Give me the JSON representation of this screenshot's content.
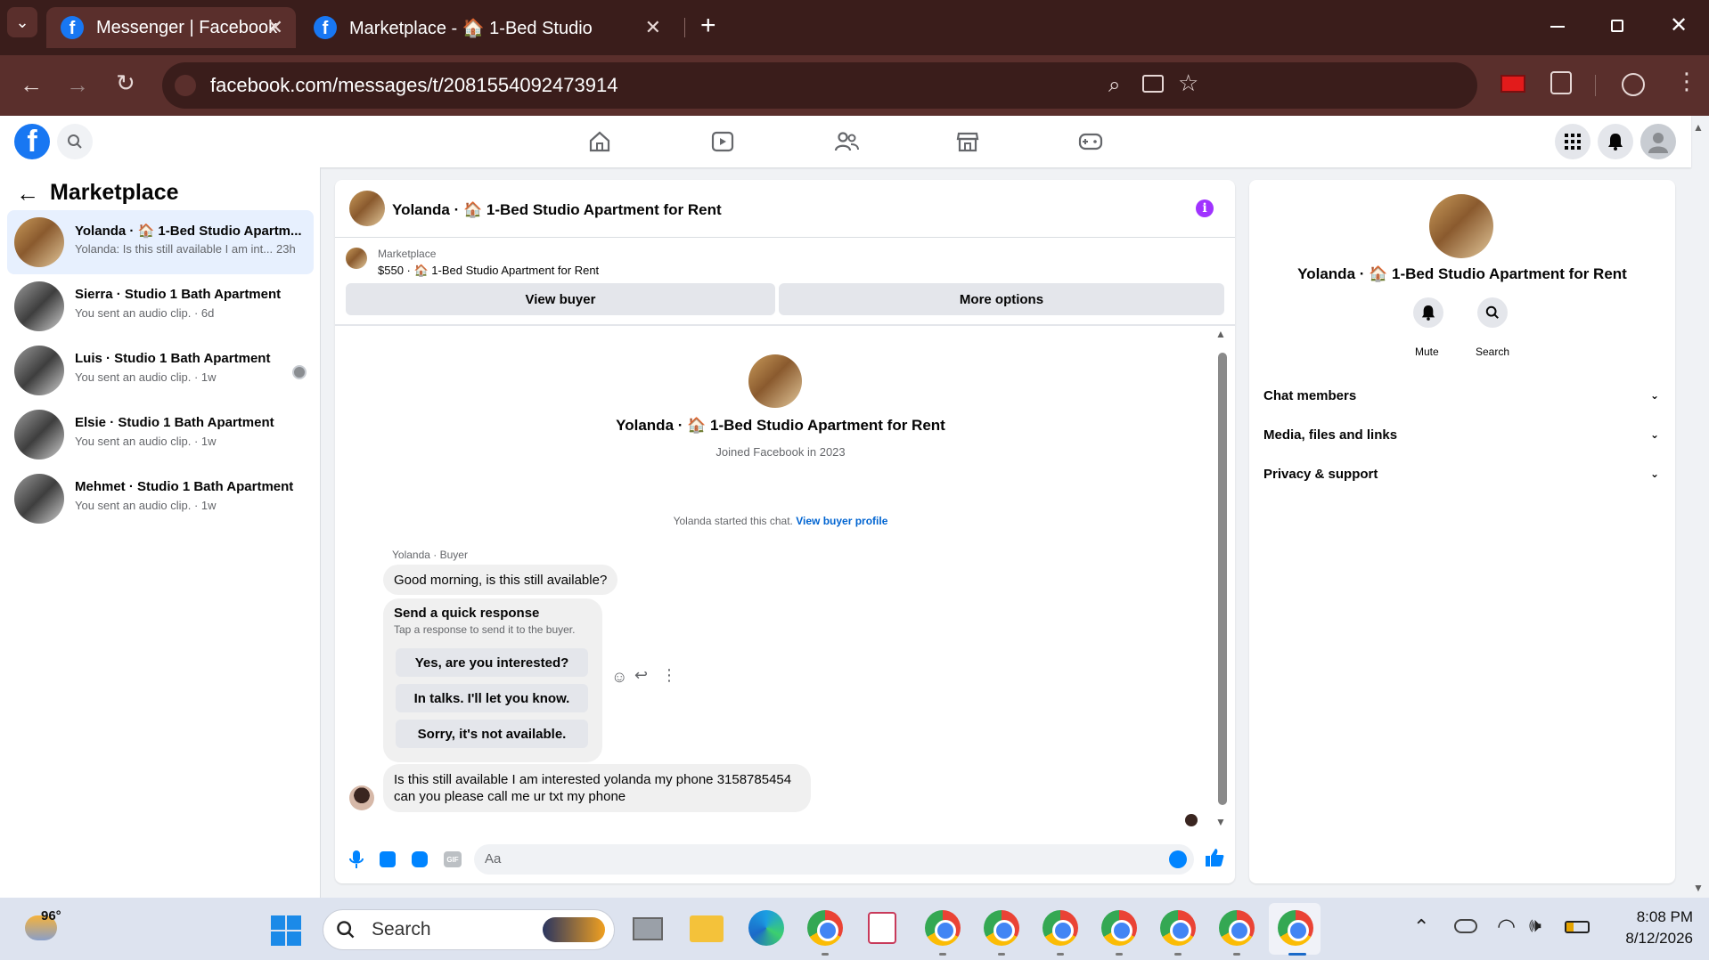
{
  "browser": {
    "tabs": [
      {
        "title": "Messenger | Facebook",
        "active": true
      },
      {
        "title": "Marketplace - 🏠 1-Bed Studio",
        "active": false
      }
    ],
    "url": "facebook.com/messages/t/2081554092473914",
    "new_tab": "+",
    "close": "✕"
  },
  "left_panel": {
    "title": "Marketplace",
    "conversations": [
      {
        "title": "Yolanda · 🏠 1-Bed Studio Apartm...",
        "snippet": "Yolanda: Is this still available I am int...",
        "time": "23h",
        "selected": true
      },
      {
        "title": "Sierra · Studio 1 Bath Apartment",
        "snippet": "You sent an audio clip. · 6d",
        "time": "",
        "selected": false
      },
      {
        "title": "Luis · Studio 1 Bath Apartment",
        "snippet": "You sent an audio clip. · 1w",
        "time": "",
        "selected": false
      },
      {
        "title": "Elsie · Studio 1 Bath Apartment",
        "snippet": "You sent an audio clip. · 1w",
        "time": "",
        "selected": false
      },
      {
        "title": "Mehmet · Studio 1 Bath Apartment",
        "snippet": "You sent an audio clip. · 1w",
        "time": "",
        "selected": false
      }
    ]
  },
  "chat": {
    "header_title": "Yolanda · 🏠 1-Bed Studio Apartment for Rent",
    "listing_label": "Marketplace",
    "listing_price": "$550 · 🏠 1-Bed Studio Apartment for Rent",
    "view_buyer": "View buyer",
    "more_options": "More options",
    "profile_name": "Yolanda · 🏠 1-Bed Studio Apartment for Rent",
    "joined": "Joined Facebook in 2023",
    "started_text": "Yolanda started this chat.",
    "view_buyer_profile": "View buyer profile",
    "sender_label": "Yolanda · Buyer",
    "message1": "Good morning, is this still available?",
    "quick_title": "Send a quick response",
    "quick_sub": "Tap a response to send it to the buyer.",
    "quick_responses": [
      "Yes, are you interested?",
      "In talks. I'll let you know.",
      "Sorry, it's not available."
    ],
    "message2": "Is this still available I am interested yolanda my phone 3158785454 can you please call me ur txt my phone",
    "composer_placeholder": "Aa",
    "gif_label": "GIF"
  },
  "right_panel": {
    "name": "Yolanda · 🏠 1-Bed Studio Apartment for Rent",
    "mute": "Mute",
    "search": "Search",
    "sections": [
      "Chat members",
      "Media, files and links",
      "Privacy & support"
    ]
  },
  "taskbar": {
    "weather": "96°",
    "search": "Search",
    "time": "8:08 PM",
    "date": "8/12/2026"
  },
  "colors": {
    "fb_blue": "#1877f2",
    "chrome_dark": "#3a1d1b",
    "chrome_mid": "#5a2f2c",
    "info_purple": "#a033ff",
    "selected_bg": "#e7f0fe"
  }
}
